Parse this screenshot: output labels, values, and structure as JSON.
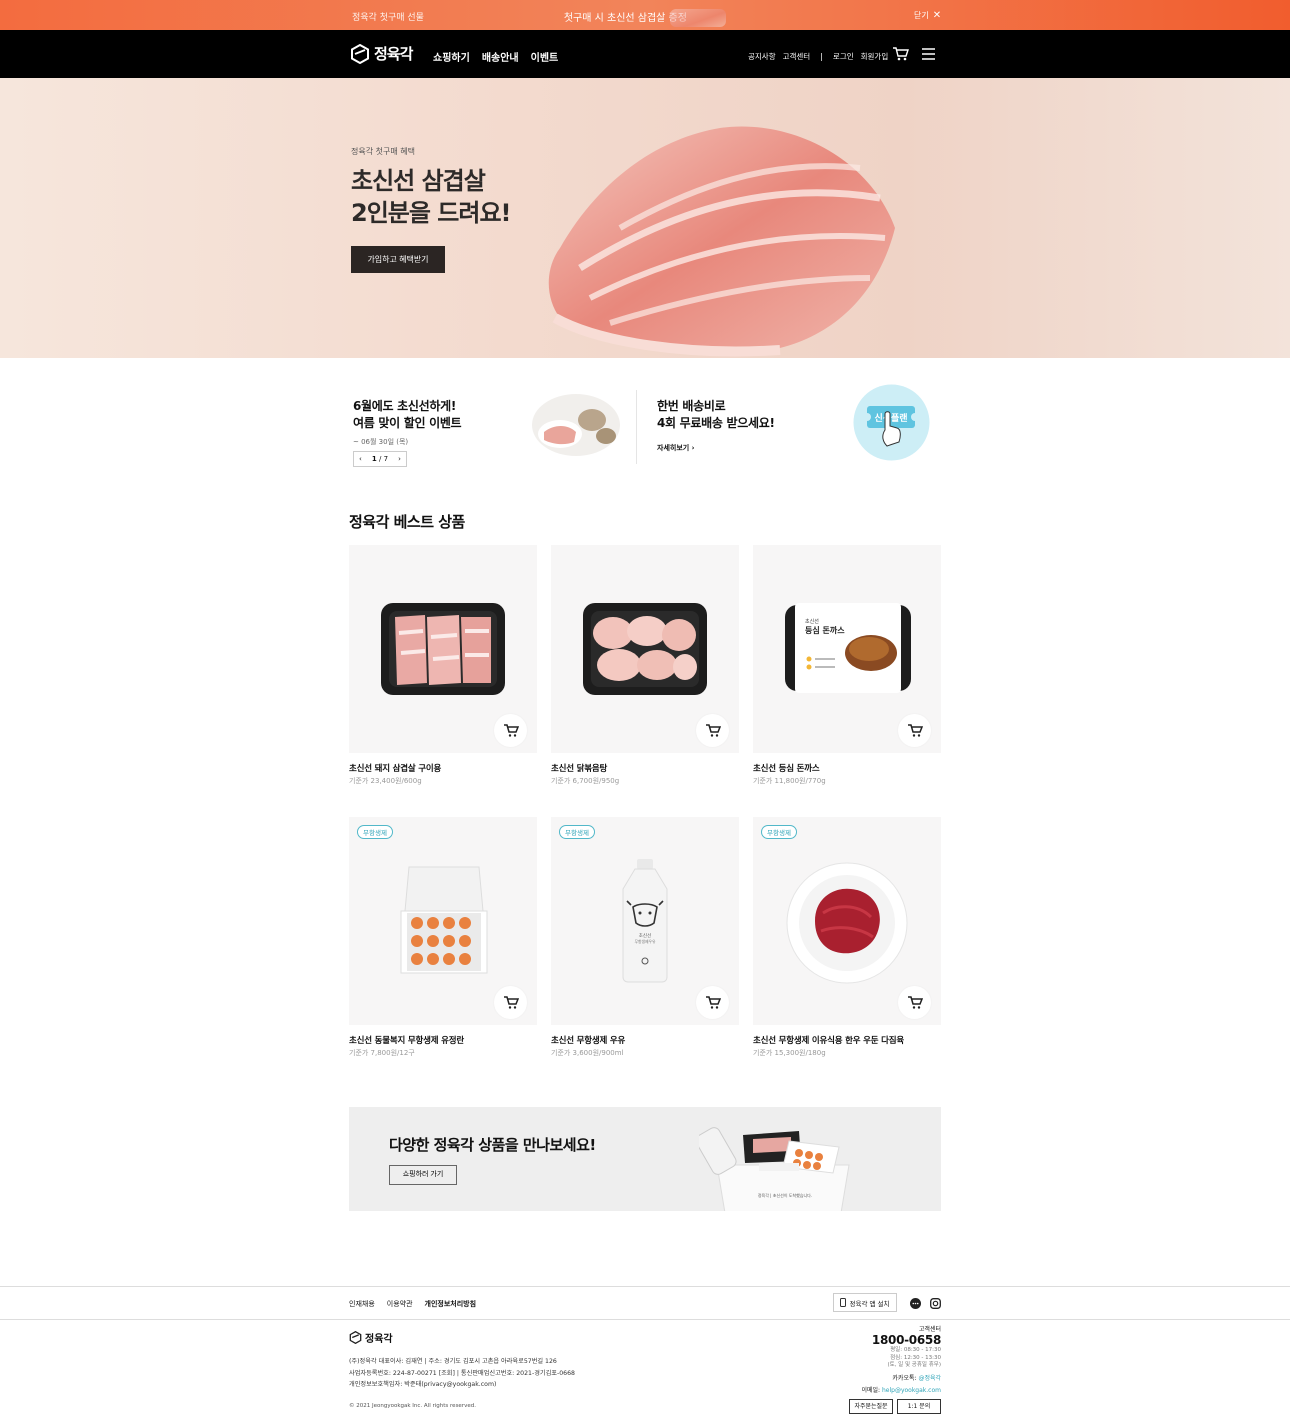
{
  "promo_bar": {
    "left_text": "정육각 첫구매 선물",
    "center_text": "첫구매 시 초신선 삼겹살 증정",
    "close_label": "닫기"
  },
  "header": {
    "brand": "정육각",
    "nav": [
      "쇼핑하기",
      "배송안내",
      "이벤트"
    ],
    "util": [
      "공지사항",
      "고객센터",
      "로그인",
      "회원가입"
    ],
    "util_separator": "|"
  },
  "hero": {
    "eyebrow": "정육각 첫구매 혜택",
    "title_line1": "초신선 삼겹살",
    "title_line2": "2인분을 드려요!",
    "cta": "가입하고 혜택받기"
  },
  "events": {
    "left": {
      "line1": "6월에도 초신선하게!",
      "line2": "여름 맞이 할인 이벤트",
      "date": "~ 06월 30일 (목)",
      "pager_current": "1",
      "pager_total": "7",
      "pager_separator": "/"
    },
    "right": {
      "line1": "한번 배송비로",
      "line2": "4회 무료배송 받으세요!",
      "more": "자세히보기",
      "badge_text": "신선플랜"
    }
  },
  "best": {
    "title": "정육각 베스트 상품",
    "products": [
      {
        "name": "초신선 돼지 삼겹살 구이용",
        "price": "기준가 23,400원/600g",
        "badge": ""
      },
      {
        "name": "초신선 닭볶음탕",
        "price": "기준가 6,700원/950g",
        "badge": ""
      },
      {
        "name": "초신선 등심 돈까스",
        "price": "기준가 11,800원/770g",
        "badge": ""
      },
      {
        "name": "초신선 동물복지 무항생제 유정란",
        "price": "기준가 7,800원/12구",
        "badge": "무항생제"
      },
      {
        "name": "초신선 무항생제 우유",
        "price": "기준가 3,600원/900ml",
        "badge": "무항생제"
      },
      {
        "name": "초신선 무항생제 이유식용 한우 우둔 다짐육",
        "price": "기준가 15,300원/180g",
        "badge": "무항생제"
      }
    ],
    "tonkatsu_pack": {
      "small": "초신선",
      "title": "등심 돈까스"
    },
    "milk_label": {
      "small": "초신선",
      "sub": "무항생제우유"
    }
  },
  "banner": {
    "title": "다양한 정육각 상품을 만나보세요!",
    "button": "쇼핑하러 가기",
    "bag_text": "정육각 | 초신선이 도착했습니다."
  },
  "footer": {
    "links": [
      "인재채용",
      "이용약관",
      "개인정보처리방침"
    ],
    "app_button": "정육각 앱 설치",
    "brand": "정육각",
    "info_line1": "(주)정육각  대표이사: 김재연  |  주소: 경기도 김포시 고촌읍 아라육로57번길 126",
    "info_line2": "사업자등록번호: 224-87-00271 [조회]  |  통신판매업신고번호: 2021-경기김포-0668",
    "info_line3": "개인정보보호책임자: 박준태(privacy@yookgak.com)",
    "copyright": "© 2021 Jeongyookgak Inc. All rights reserved.",
    "cs_label": "고객센터",
    "cs_tel": "1800-0658",
    "cs_hours": [
      "평일: 08:30 - 17:30",
      "점심: 12:30 - 13:30",
      "(토, 일 및 공휴일 휴무)"
    ],
    "kakao_label": "카카오톡:",
    "kakao_value": "@정육각",
    "email_label": "이메일:",
    "email_value": "help@yookgak.com",
    "btn_faq": "자주묻는질문",
    "btn_inquiry": "1:1 문의"
  },
  "colors": {
    "promo_bar": "#f36c3f",
    "header_bg": "#000000",
    "accent_teal": "#2fa4b8",
    "hero_button": "#2b2523"
  },
  "icons": [
    "logo-icon",
    "close-icon",
    "cart-icon",
    "menu-icon",
    "chevron-left-icon",
    "chevron-right-icon",
    "add-to-cart-icon",
    "mobile-icon",
    "chat-icon",
    "instagram-icon"
  ]
}
